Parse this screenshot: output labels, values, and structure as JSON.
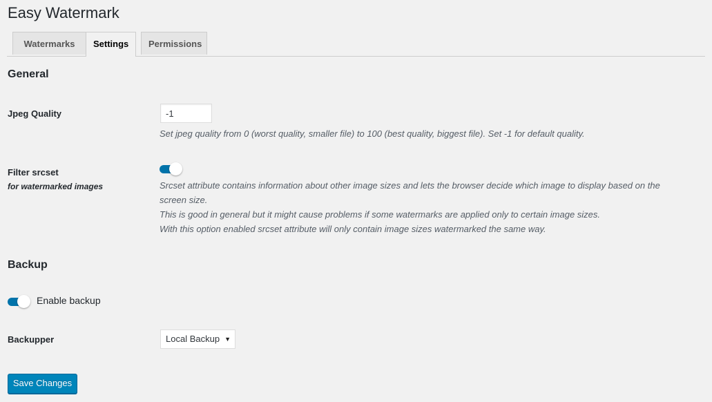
{
  "page": {
    "title": "Easy Watermark"
  },
  "tabs": [
    {
      "label": "Watermarks",
      "active": false
    },
    {
      "label": "Settings",
      "active": true
    },
    {
      "label": "Permissions",
      "active": false
    }
  ],
  "general": {
    "title": "General",
    "jpeg_quality": {
      "label": "Jpeg Quality",
      "value": "-1",
      "description": "Set jpeg quality from 0 (worst quality, smaller file) to 100 (best quality, biggest file). Set -1 for default quality."
    },
    "filter_srcset": {
      "label": "Filter srcset",
      "sublabel": "for watermarked images",
      "enabled": true,
      "description_lines": [
        "Srcset attribute contains information about other image sizes and lets the browser decide which image to display based on the",
        "screen size.",
        "This is good in general but it might cause problems if some watermarks are applied only to certain image sizes.",
        "With this option enabled srcset attribute will only contain image sizes watermarked the same way."
      ]
    }
  },
  "backup": {
    "title": "Backup",
    "enable_backup": {
      "label": "Enable backup",
      "enabled": true
    },
    "backupper": {
      "label": "Backupper",
      "selected": "Local Backup",
      "arrow": "▼"
    }
  },
  "actions": {
    "save_label": "Save Changes"
  },
  "colors": {
    "accent": "#0073aa",
    "primary_button": "#0085ba",
    "background": "#f1f1f1"
  }
}
